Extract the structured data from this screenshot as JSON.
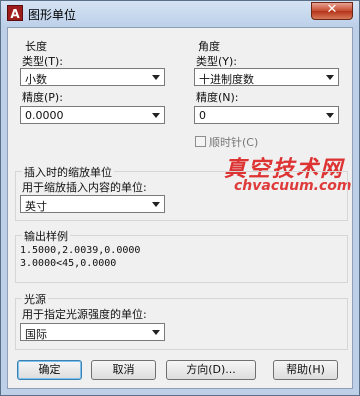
{
  "window": {
    "title": "图形单位",
    "app_icon": "A",
    "close": "✕"
  },
  "length": {
    "heading": "长度",
    "type_label": "类型(T):",
    "type_value": "小数",
    "precision_label": "精度(P):",
    "precision_value": "0.0000"
  },
  "angle": {
    "heading": "角度",
    "type_label": "类型(Y):",
    "type_value": "十进制度数",
    "precision_label": "精度(N):",
    "precision_value": "0",
    "clockwise_label": "顺时针(C)"
  },
  "insertion": {
    "heading": "插入时的缩放单位",
    "label": "用于缩放插入内容的单位:",
    "value": "英寸"
  },
  "sample": {
    "heading": "输出样例",
    "line1": "1.5000,2.0039,0.0000",
    "line2": "3.0000<45,0.0000"
  },
  "lighting": {
    "heading": "光源",
    "label": "用于指定光源强度的单位:",
    "value": "国际"
  },
  "buttons": {
    "ok": "确定",
    "cancel": "取消",
    "direction": "方向(D)...",
    "help": "帮助(H)"
  },
  "watermark": {
    "cn": "真空技术网",
    "url": "chvacuum.com"
  }
}
